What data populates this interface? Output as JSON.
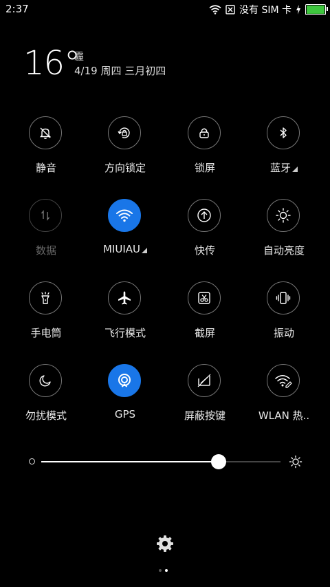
{
  "status_bar": {
    "time": "2:37",
    "carrier": "没有 SIM 卡",
    "battery_level": 1.0,
    "battery_color": "#3ec63e"
  },
  "weather": {
    "temperature": "16°",
    "condition": "霾",
    "date": "4/19 周四 三月初四"
  },
  "colors": {
    "active": "#1976e8",
    "inactive_border": "#777777"
  },
  "toggles": [
    {
      "label": "静音",
      "icon": "mute-bell-icon",
      "active": false
    },
    {
      "label": "方向锁定",
      "icon": "rotation-lock-icon",
      "active": false
    },
    {
      "label": "锁屏",
      "icon": "lock-icon",
      "active": false
    },
    {
      "label": "蓝牙",
      "icon": "bluetooth-icon",
      "active": false,
      "has_more": true
    },
    {
      "label": "数据",
      "icon": "mobile-data-icon",
      "active": false,
      "disabled": true
    },
    {
      "label": "MIUIAU",
      "icon": "wifi-icon",
      "active": true,
      "has_more": true
    },
    {
      "label": "快传",
      "icon": "quick-share-icon",
      "active": false
    },
    {
      "label": "自动亮度",
      "icon": "auto-brightness-icon",
      "active": false
    },
    {
      "label": "手电筒",
      "icon": "flashlight-icon",
      "active": false
    },
    {
      "label": "飞行模式",
      "icon": "airplane-icon",
      "active": false
    },
    {
      "label": "截屏",
      "icon": "screenshot-icon",
      "active": false
    },
    {
      "label": "振动",
      "icon": "vibrate-icon",
      "active": false
    },
    {
      "label": "勿扰模式",
      "icon": "do-not-disturb-moon-icon",
      "active": false
    },
    {
      "label": "GPS",
      "icon": "gps-icon",
      "active": true
    },
    {
      "label": "屏蔽按键",
      "icon": "block-keys-icon",
      "active": false
    },
    {
      "label": "WLAN 热..",
      "icon": "wlan-hotspot-icon",
      "active": false
    }
  ],
  "brightness": {
    "level": 0.74
  },
  "pager": {
    "pages": 2,
    "current": 2
  }
}
